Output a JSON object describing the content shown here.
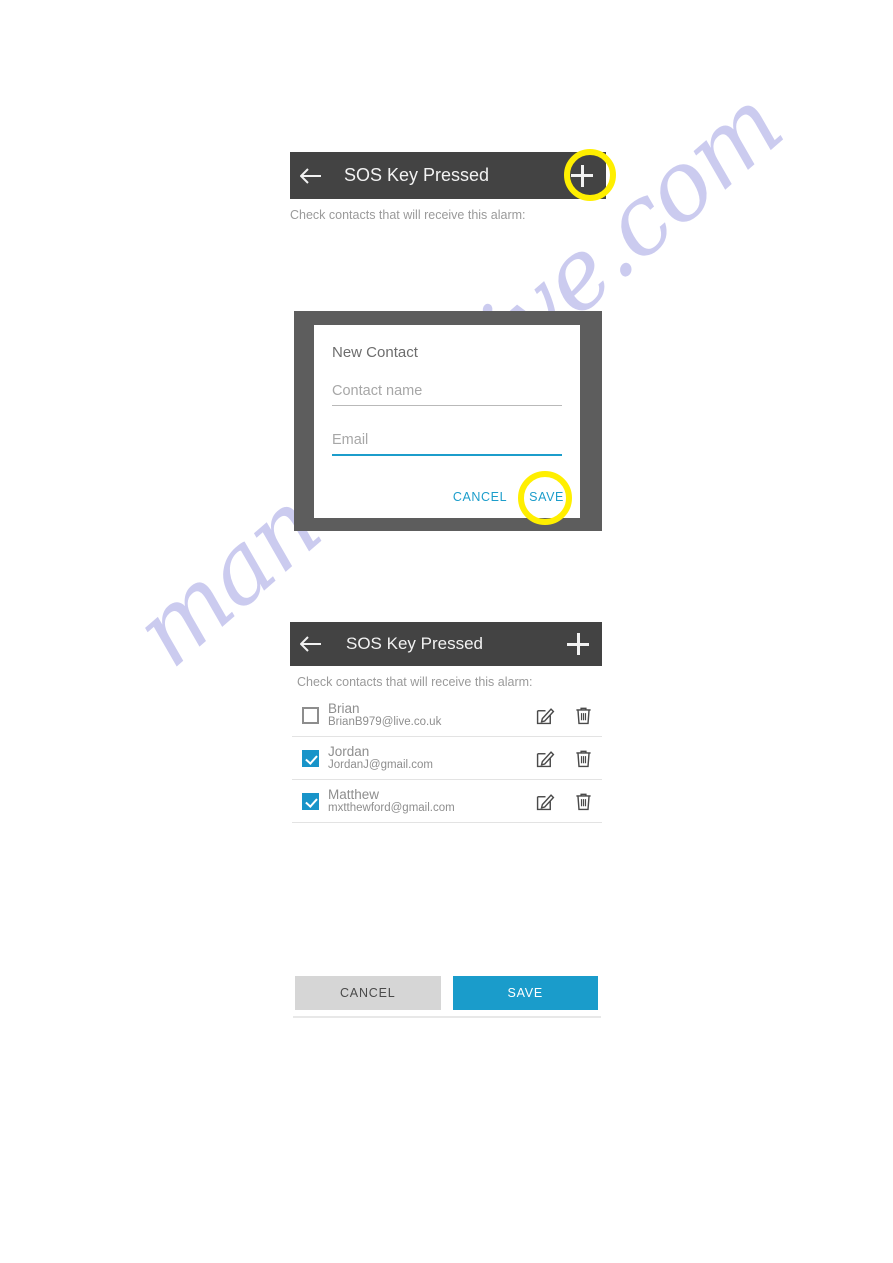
{
  "watermark": {
    "text": "manualshive.com",
    "color": "#c9c9ef"
  },
  "theme": {
    "appbar_bg": "#434343",
    "accent": "#1a9ccb",
    "highlight_ring": "#ffef00",
    "scrim": "#5d5d5d",
    "muted_text": "#8e8e8e"
  },
  "screen_one": {
    "appbar": {
      "back_icon": "arrow-left-icon",
      "title": "SOS Key Pressed",
      "add_icon": "plus-icon"
    },
    "hint": "Check contacts that will receive this alarm:"
  },
  "dialog": {
    "title": "New Contact",
    "fields": [
      {
        "name": "contact-name",
        "placeholder": "Contact name",
        "value": "",
        "focused": false
      },
      {
        "name": "email",
        "placeholder": "Email",
        "value": "",
        "focused": true
      }
    ],
    "cancel_label": "CANCEL",
    "save_label": "SAVE"
  },
  "screen_two": {
    "appbar": {
      "back_icon": "arrow-left-icon",
      "title": "SOS Key Pressed",
      "add_icon": "plus-icon"
    },
    "hint": "Check contacts that will receive this alarm:",
    "contacts": [
      {
        "name": "Brian",
        "email": "BrianB979@live.co.uk",
        "checked": false
      },
      {
        "name": "Jordan",
        "email": "JordanJ@gmail.com",
        "checked": true
      },
      {
        "name": "Matthew",
        "email": "mxtthewford@gmail.com",
        "checked": true
      }
    ],
    "row_icons": {
      "edit": "edit-pencil-icon",
      "delete": "trash-icon"
    },
    "cancel_label": "CANCEL",
    "save_label": "SAVE"
  }
}
